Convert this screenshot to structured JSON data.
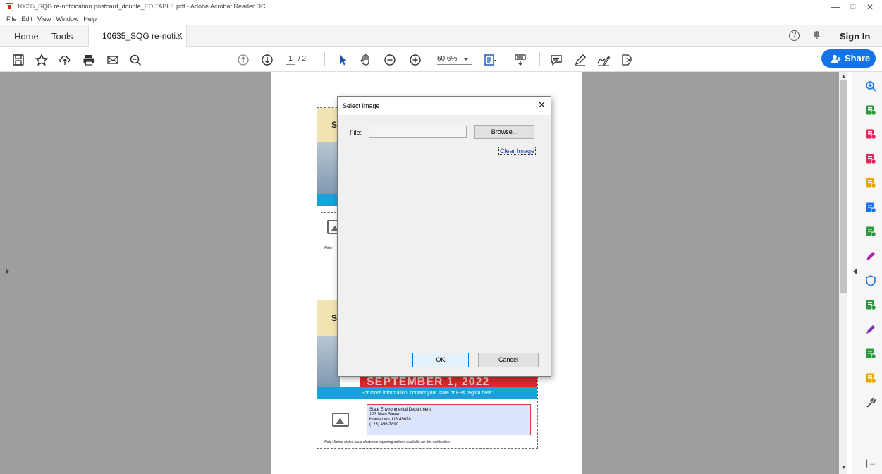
{
  "window": {
    "title": "10635_SQG re-notification postcard_double_EDITABLE.pdf - Adobe Acrobat Reader DC",
    "minimize": "—",
    "maximize": "□",
    "close": "✕"
  },
  "menu": [
    "File",
    "Edit",
    "View",
    "Window",
    "Help"
  ],
  "tabs": {
    "home": "Home",
    "tools": "Tools",
    "document": "10635_SQG re-noti...",
    "document_close": "✕",
    "help": "?",
    "signin": "Sign In"
  },
  "toolbar": {
    "page_current": "1",
    "page_total": "/ 2",
    "zoom": "60.6%",
    "share_label": "Share",
    "icons": [
      "save-icon",
      "star-icon",
      "upload-icon",
      "print-icon",
      "email-icon",
      "zoom-search-icon",
      "page-up-icon",
      "page-down-icon",
      "select-arrow-icon",
      "hand-icon",
      "zoom-out-icon",
      "zoom-in-icon",
      "fit-page-icon",
      "scroll-mode-icon",
      "comment-icon",
      "highlight-pen-icon",
      "sign-icon",
      "read-aloud-icon"
    ]
  },
  "document": {
    "card_letter": "S",
    "info_bar": "For more information, contact your state or EPA region here:",
    "address_lines": [
      "State Environmental Department",
      "123 Main Street",
      "Hometown, US 45678",
      "(123) 456-7890"
    ],
    "note_short": "Note:",
    "note_full": "Note: Some states have electronic reporting options available for this notification.",
    "red_banner": "SEPTEMBER 1, 2022"
  },
  "dialog": {
    "title": "Select Image",
    "close": "✕",
    "file_label": "File:",
    "file_value": "",
    "browse_label": "Browse...",
    "clear_label": "Clear Image",
    "ok_label": "OK",
    "cancel_label": "Cancel"
  },
  "right_panel": {
    "icons": [
      "zoom-tool-icon",
      "create-pdf-icon",
      "organize-pages-icon",
      "export-pdf-icon",
      "comment-tool-icon",
      "combine-files-icon",
      "edit-pdf-icon",
      "fill-sign-icon",
      "protect-icon",
      "compare-icon",
      "request-signature-icon",
      "print-production-icon",
      "export-icon",
      "more-tools-icon"
    ],
    "colors": [
      "#1a73e8",
      "#2b9a3f",
      "#e2275b",
      "#e2275b",
      "#e7a600",
      "#1a73e8",
      "#2b9a3f",
      "#b31aa3",
      "#1a73e8",
      "#2b9a3f",
      "#7b2fb6",
      "#2b9a3f",
      "#e7a600",
      "#444444"
    ],
    "expand": "|→"
  }
}
